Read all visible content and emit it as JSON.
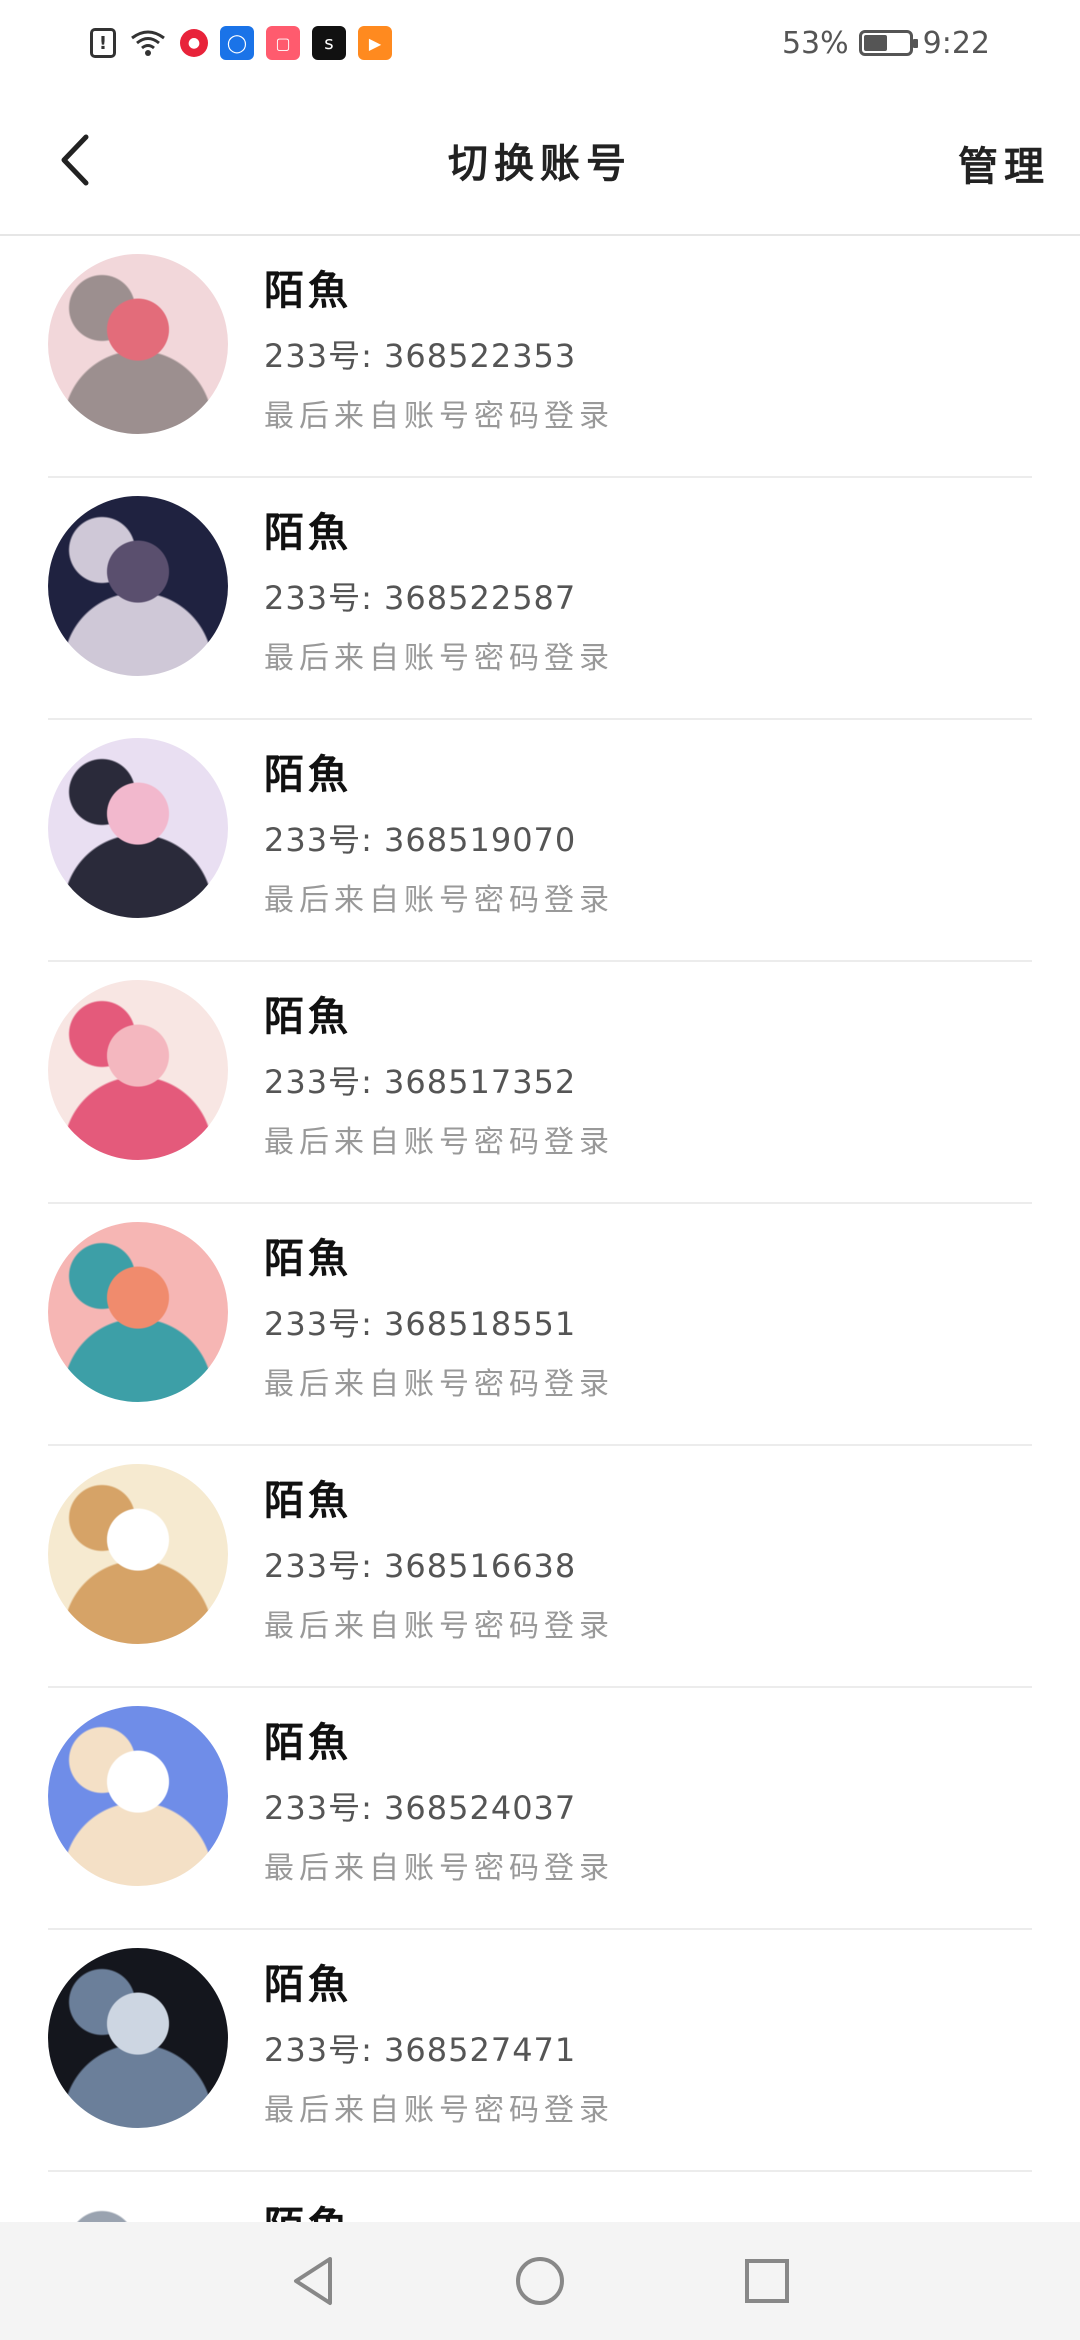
{
  "status_bar": {
    "battery_percent": "53%",
    "time": "9:22",
    "battery_level": 0.53,
    "icons": [
      "alert-icon",
      "wifi-icon",
      "red-app-icon",
      "blue-app-icon",
      "red-book-icon",
      "black-app-icon",
      "orange-play-icon"
    ]
  },
  "header": {
    "title": "切换账号",
    "manage_label": "管理"
  },
  "accounts": [
    {
      "name": "陌魚",
      "uid": "233号: 368522353",
      "login": "最后来自账号密码登录",
      "avatar_colors": [
        "#f2d7da",
        "#9c8f8f",
        "#e36c7a"
      ]
    },
    {
      "name": "陌魚",
      "uid": "233号: 368522587",
      "login": "最后来自账号密码登录",
      "avatar_colors": [
        "#1f2240",
        "#cfc8d7",
        "#5a4f6e"
      ]
    },
    {
      "name": "陌魚",
      "uid": "233号: 368519070",
      "login": "最后来自账号密码登录",
      "avatar_colors": [
        "#e9dff2",
        "#2a2a3a",
        "#f2b8cd"
      ]
    },
    {
      "name": "陌魚",
      "uid": "233号: 368517352",
      "login": "最后来自账号密码登录",
      "avatar_colors": [
        "#f8e6e3",
        "#e45a7b",
        "#f4b7bf"
      ]
    },
    {
      "name": "陌魚",
      "uid": "233号: 368518551",
      "login": "最后来自账号密码登录",
      "avatar_colors": [
        "#f6b6b4",
        "#3d9fa7",
        "#f08b6d"
      ]
    },
    {
      "name": "陌魚",
      "uid": "233号: 368516638",
      "login": "最后来自账号密码登录",
      "avatar_colors": [
        "#f6ead0",
        "#d6a367",
        "#ffffff"
      ]
    },
    {
      "name": "陌魚",
      "uid": "233号: 368524037",
      "login": "最后来自账号密码登录",
      "avatar_colors": [
        "#6f8de8",
        "#f4e0c6",
        "#ffffff"
      ]
    },
    {
      "name": "陌魚",
      "uid": "233号: 368527471",
      "login": "最后来自账号密码登录",
      "avatar_colors": [
        "#14161d",
        "#6b7f9a",
        "#cdd6e2"
      ]
    },
    {
      "name": "陌魚",
      "uid": "",
      "login": "",
      "avatar_colors": [
        "#ffffff",
        "#9aa3b0",
        "#d6dbe3"
      ]
    }
  ]
}
